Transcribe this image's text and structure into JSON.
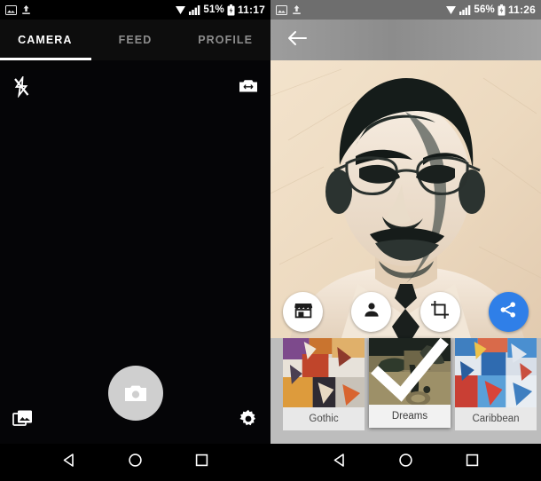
{
  "left_phone": {
    "statusbar": {
      "icons": [
        "screenshot-icon",
        "upload-icon",
        "wifi-icon",
        "signal-icon",
        "battery-icon"
      ],
      "battery_pct": "51%",
      "time": "11:17"
    },
    "tabs": [
      {
        "label": "CAMERA",
        "active": true
      },
      {
        "label": "FEED",
        "active": false
      },
      {
        "label": "PROFILE",
        "active": false
      }
    ],
    "camera_controls": {
      "flash": "flash-off-icon",
      "switch": "switch-camera-icon",
      "shutter": "shutter-button",
      "gallery": "gallery-icon",
      "settings": "settings-gear-icon"
    },
    "navbar": [
      "back-icon",
      "home-icon",
      "recents-icon"
    ]
  },
  "right_phone": {
    "statusbar": {
      "battery_pct": "56%",
      "time": "11:26"
    },
    "appbar": {
      "back": "back-arrow-icon"
    },
    "photo": {
      "alt": "stylized-portrait-preview"
    },
    "actions": [
      {
        "name": "store-button",
        "icon": "storefront-icon"
      },
      {
        "name": "portrait-button",
        "icon": "person-icon"
      },
      {
        "name": "crop-button",
        "icon": "crop-icon"
      },
      {
        "name": "share-button",
        "icon": "share-icon",
        "accent": "#2f7fe8"
      }
    ],
    "filters": [
      {
        "label": "Gothic",
        "selected": false
      },
      {
        "label": "Dreams",
        "selected": true
      },
      {
        "label": "Caribbean",
        "selected": false
      }
    ],
    "navbar": [
      "back-icon",
      "home-icon",
      "recents-icon"
    ]
  },
  "colors": {
    "accent_blue": "#2f7fe8",
    "dark_bg": "#000000",
    "strip_bg": "#bdbdbd"
  }
}
